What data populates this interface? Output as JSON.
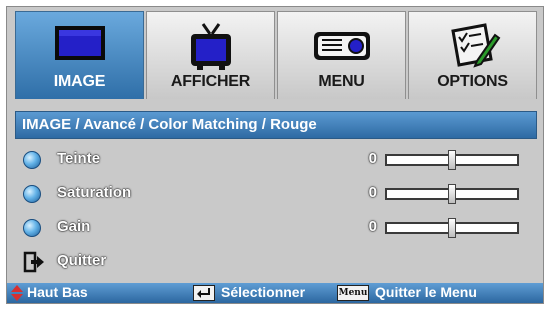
{
  "tabs": [
    {
      "label": "IMAGE",
      "icon": "monitor-icon",
      "active": true
    },
    {
      "label": "AFFICHER",
      "icon": "tv-icon",
      "active": false
    },
    {
      "label": "MENU",
      "icon": "projector-icon",
      "active": false
    },
    {
      "label": "OPTIONS",
      "icon": "checklist-icon",
      "active": false
    }
  ],
  "breadcrumb": "IMAGE / Avancé / Color Matching / Rouge",
  "settings": [
    {
      "label": "Teinte",
      "value": "0",
      "level": 0.5
    },
    {
      "label": "Saturation",
      "value": "0",
      "level": 0.5
    },
    {
      "label": "Gain",
      "value": "0",
      "level": 0.5
    }
  ],
  "exit_label": "Quitter",
  "footer": {
    "nav_text": "Haut Bas",
    "select_text": "Sélectionner",
    "menu_key": "Menu",
    "exit_text": "Quitter le Menu"
  },
  "colors": {
    "accent_blue": "#2f6fa8",
    "panel_gray": "#c9c9c9",
    "nav_red": "#d83030"
  }
}
